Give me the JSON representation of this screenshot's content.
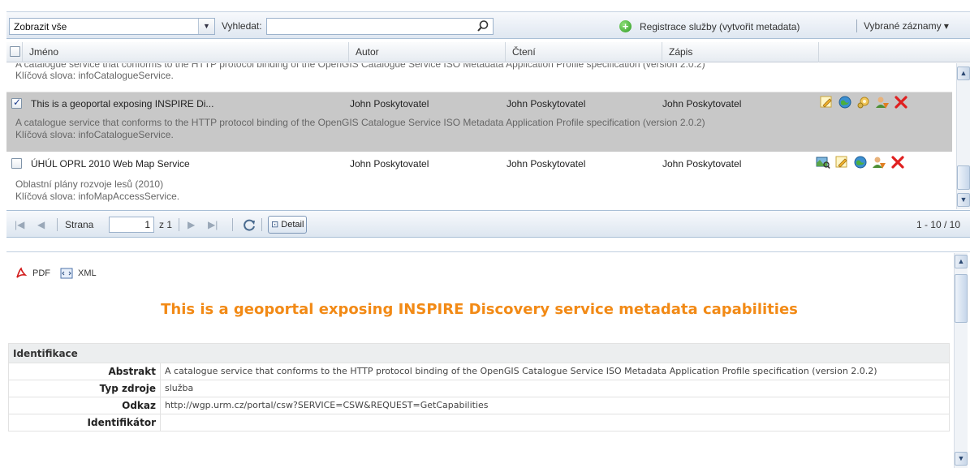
{
  "toolbar": {
    "filter_value": "Zobrazit vše",
    "search_label": "Vyhledat:",
    "search_value": "",
    "register_label": "Registrace služby (vytvořit metadata)",
    "selected_label": "Vybrané záznamy ▾"
  },
  "grid": {
    "columns": [
      "Jméno",
      "Autor",
      "Čtení",
      "Zápis"
    ],
    "partial_row": {
      "desc_line1": "A catalogue service that conforms to the HTTP protocol binding of the OpenGIS Catalogue Service ISO Metadata Application Profile specification (version 2.0.2)",
      "keywords": "Klíčová slova: infoCatalogueService."
    },
    "rows": [
      {
        "name": "This is a geoportal exposing INSPIRE Di...",
        "author": "John Poskytovatel",
        "read": "John Poskytovatel",
        "write": "John Poskytovatel",
        "checked": true,
        "description": "A catalogue service that conforms to the HTTP protocol binding of the OpenGIS Catalogue Service ISO Metadata Application Profile specification (version 2.0.2)",
        "keywords": "Klíčová slova: infoCatalogueService.",
        "icons": [
          "edit-icon",
          "globe-icon",
          "settings-icon",
          "user-permissions-icon",
          "delete-icon"
        ]
      },
      {
        "name": "ÚHÚL OPRL 2010 Web Map Service",
        "author": "John Poskytovatel",
        "read": "John Poskytovatel",
        "write": "John Poskytovatel",
        "checked": false,
        "description": "Oblastní plány rozvoje lesů (2010)",
        "keywords": "Klíčová slova: infoMapAccessService.",
        "icons": [
          "map-preview-icon",
          "edit-icon",
          "globe-icon",
          "user-permissions-icon",
          "delete-icon"
        ]
      }
    ]
  },
  "pager": {
    "page_label": "Strana",
    "page_value": "1",
    "of_label": "z 1",
    "detail_label": "Detail",
    "range": "1 - 10 / 10"
  },
  "detail": {
    "pdf_label": "PDF",
    "xml_label": "XML",
    "title": "This is a geoportal exposing INSPIRE Discovery service metadata capabilities",
    "section": "Identifikace",
    "fields": [
      {
        "key": "Abstrakt",
        "value": "A catalogue service that conforms to the HTTP protocol binding of the OpenGIS Catalogue Service ISO Metadata Application Profile specification (version 2.0.2)"
      },
      {
        "key": "Typ zdroje",
        "value": "služba"
      },
      {
        "key": "Odkaz",
        "value": "http://wgp.urm.cz/portal/csw?SERVICE=CSW&REQUEST=GetCapabilities"
      },
      {
        "key": "Identifikátor",
        "value": ""
      }
    ]
  },
  "colors": {
    "title_orange": "#f28a16",
    "selected_row": "#c8c8c8",
    "delete_red": "#e02020",
    "toolbar_blue": "#dfe7f1"
  }
}
